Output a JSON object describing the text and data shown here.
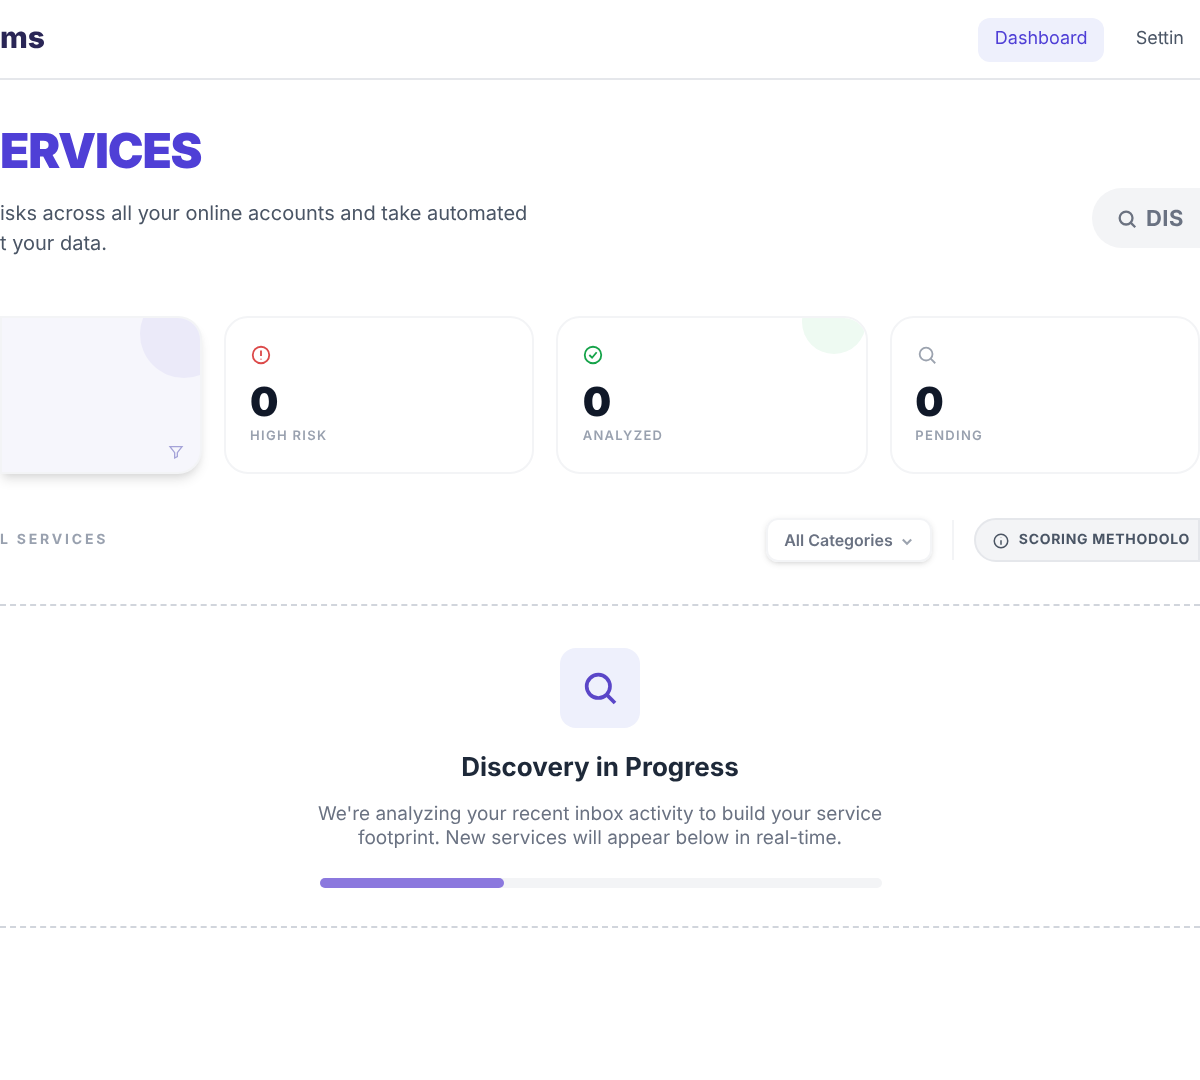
{
  "header": {
    "logo": "ms",
    "nav": [
      {
        "label": "Dashboard",
        "selected": true
      },
      {
        "label": "Settin",
        "selected": false
      }
    ]
  },
  "hero": {
    "title": "ERVICES",
    "description": [
      "isks across all your online accounts and take automated",
      "t your data."
    ],
    "action": "DIS"
  },
  "stats": [
    {
      "kind": "blank"
    },
    {
      "kind": "risk",
      "value": "0",
      "label": "HIGH RISK"
    },
    {
      "kind": "analyzed",
      "value": "0",
      "label": "ANALYZED"
    },
    {
      "kind": "pending",
      "value": "0",
      "label": "PENDING"
    }
  ],
  "toolbar": {
    "section_label": "L SERVICES",
    "filter": "All Categories",
    "methodology": "SCORING METHODOLO"
  },
  "discovery": {
    "title": "Discovery in Progress",
    "text": "We're analyzing your recent inbox activity to build your service footprint. New services will appear below in real-time.",
    "level": 0.33
  }
}
